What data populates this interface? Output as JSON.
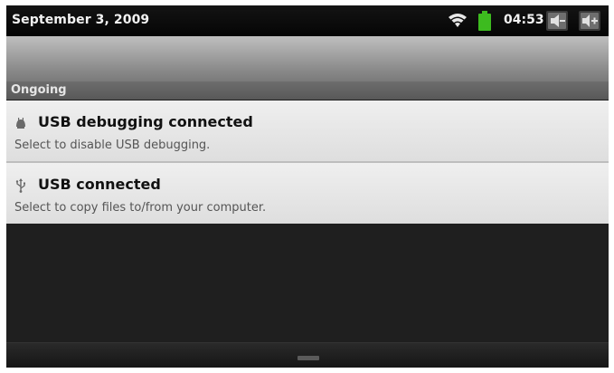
{
  "status_bar": {
    "date": "September 3, 2009",
    "time": "04:53",
    "icons": [
      "wifi-icon",
      "battery-icon",
      "volume-down-icon",
      "volume-up-icon"
    ],
    "battery_color": "#3dbb1f"
  },
  "section": {
    "label": "Ongoing"
  },
  "notifications": [
    {
      "icon": "debug-icon",
      "title": "USB debugging connected",
      "description": "Select to disable USB debugging."
    },
    {
      "icon": "usb-icon",
      "title": "USB connected",
      "description": "Select to copy files to/from your computer."
    }
  ]
}
